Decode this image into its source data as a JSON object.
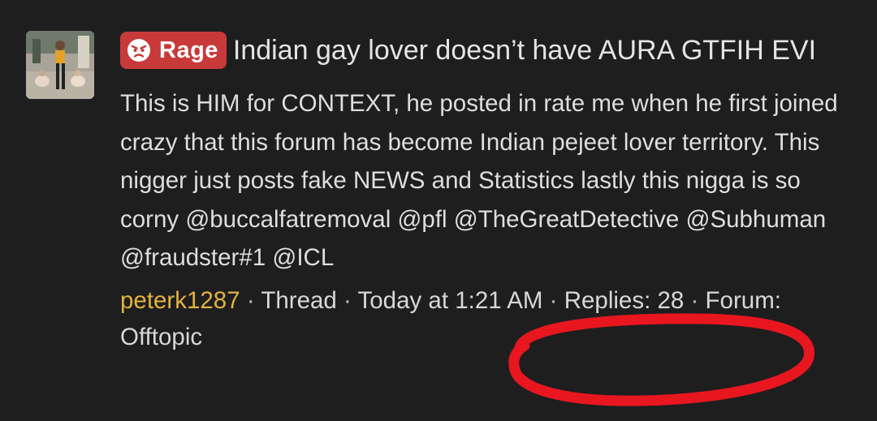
{
  "thread": {
    "prefix_label": "Rage",
    "title": "Indian gay lover doesn’t have AURA GTFIH EVI",
    "snippet": "This is HIM for CONTEXT, he posted in rate me when he first joined crazy that this forum has become Indian pejeet lover territory. This nigger just posts fake NEWS and Statistics lastly this nigga is so corny @buccalfatremoval @pfl @TheGreatDetective @Subhuman @fraudster#1 @ICL",
    "author": "peterk1287",
    "separator": "·",
    "type": "Thread",
    "date": "Today at 1:21 AM",
    "replies_label": "Replies: 28",
    "forum_label": "Forum: Offtopic"
  },
  "colors": {
    "badge_bg": "#c83a3a",
    "author": "#e3b341",
    "annotation_circle": "#e8161f"
  },
  "icons": {
    "badge": "angry-face-icon",
    "avatar": "user-avatar"
  }
}
